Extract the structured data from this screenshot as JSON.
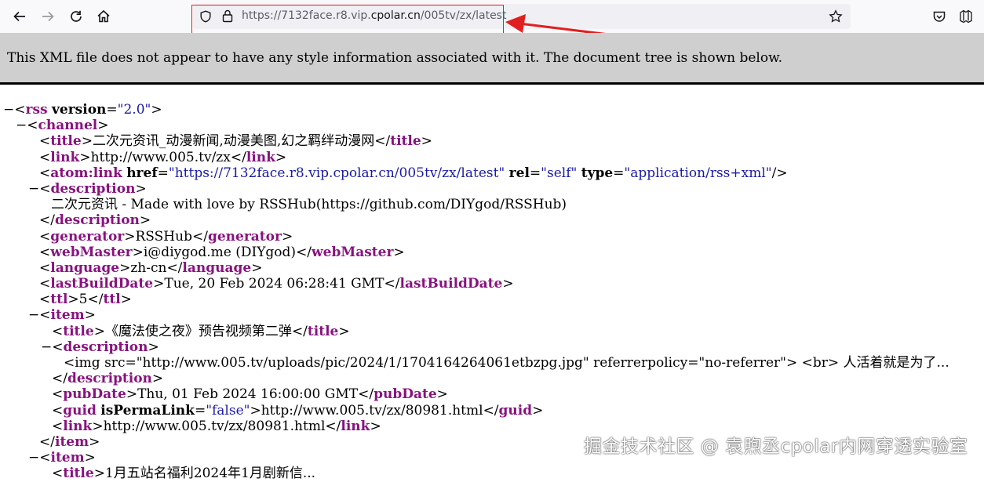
{
  "browser": {
    "url_prefix": "https://7132face.r8.vip.",
    "url_domain": "cpolar.cn",
    "url_suffix": "/005tv/zx/latest",
    "icons": [
      "back-icon",
      "forward-icon",
      "reload-icon",
      "home-icon",
      "shield-icon",
      "lock-icon",
      "bookmark-star-icon",
      "pocket-icon",
      "extensions-icon"
    ],
    "annotation_color": "#e02020"
  },
  "banner": {
    "text": "This XML file does not appear to have any style information associated with it. The document tree is shown below."
  },
  "tree": {
    "rss": {
      "tag": "rss",
      "attr": "version",
      "val": "\"2.0\""
    },
    "channel": "channel",
    "title_tag": "title",
    "title_text": "二次元资讯_动漫新闻,动漫美图,幻之羁绊动漫网",
    "link_tag": "link",
    "link_text": "http://www.005.tv/zx",
    "atom": {
      "tag": "atom:link",
      "href_attr": "href",
      "href_val": "\"https://7132face.r8.vip.cpolar.cn/005tv/zx/latest\"",
      "rel_attr": "rel",
      "rel_val": "\"self\"",
      "type_attr": "type",
      "type_val": "\"application/rss+xml\""
    },
    "desc_tag": "description",
    "desc_text": "二次元资讯 - Made with love by RSSHub(https://github.com/DIYgod/RSSHub)",
    "generator_tag": "generator",
    "generator_text": "RSSHub",
    "webmaster_tag": "webMaster",
    "webmaster_text": "i@diygod.me (DIYgod)",
    "language_tag": "language",
    "language_text": "zh-cn",
    "lastbuild_tag": "lastBuildDate",
    "lastbuild_text": "Tue, 20 Feb 2024 06:28:41 GMT",
    "ttl_tag": "ttl",
    "ttl_text": "5",
    "item_tag": "item",
    "item1": {
      "title_text": "《魔法使之夜》预告视频第二弹",
      "desc_text": "<img src=\"http://www.005.tv/uploads/pic/2024/1/1704164264061etbzpg.jpg\" referrerpolicy=\"no-referrer\"> <br> 人活着就是为了...",
      "pubdate_tag": "pubDate",
      "pubdate_text": "Thu, 01 Feb 2024 16:00:00 GMT",
      "guid_tag": "guid",
      "guid_attr": "isPermaLink",
      "guid_val": "\"false\"",
      "guid_text": "http://www.005.tv/zx/80981.html",
      "link_text": "http://www.005.tv/zx/80981.html"
    },
    "item2": {
      "title_partial": "1月五站名福利2024年1月剧新信..."
    }
  },
  "watermark": "掘金技术社区 @ 袁煦丞cpolar内网穿透实验室"
}
